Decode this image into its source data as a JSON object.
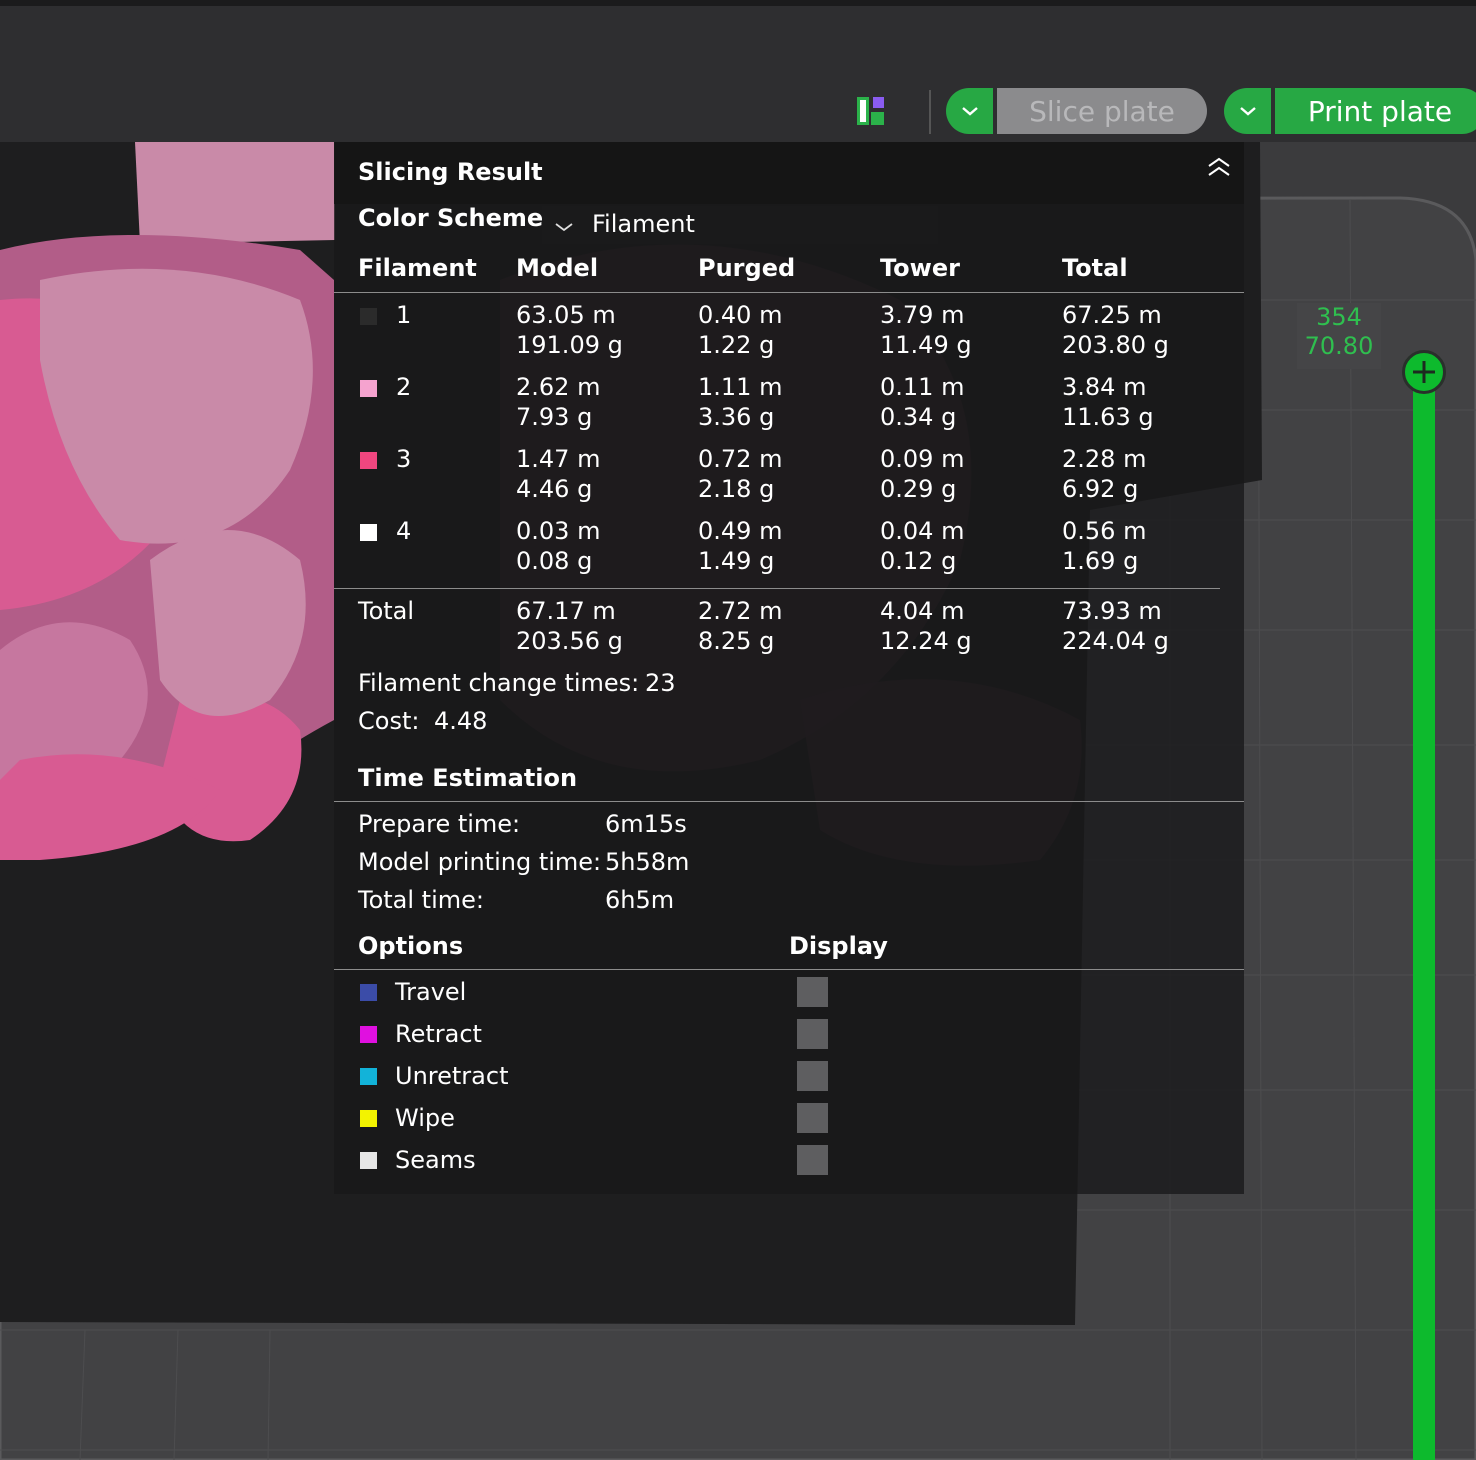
{
  "toolbar": {
    "slice_label": "Slice plate",
    "print_label": "Print plate",
    "layout_icon": "layout-grid-icon"
  },
  "layer_slider": {
    "top_layer": "354",
    "height": "70.80"
  },
  "panel": {
    "title": "Slicing Result",
    "color_scheme_label": "Color Scheme",
    "color_scheme_value": "Filament",
    "columns": [
      "Filament",
      "Model",
      "Purged",
      "Tower",
      "Total"
    ],
    "rows": [
      {
        "id": "1",
        "color": "#2b2b2b",
        "model_m": "63.05 m",
        "model_g": "191.09 g",
        "purged_m": "0.40 m",
        "purged_g": "1.22 g",
        "tower_m": "3.79 m",
        "tower_g": "11.49 g",
        "total_m": "67.25 m",
        "total_g": "203.80 g"
      },
      {
        "id": "2",
        "color": "#f5a3cf",
        "model_m": "2.62 m",
        "model_g": "7.93 g",
        "purged_m": "1.11 m",
        "purged_g": "3.36 g",
        "tower_m": "0.11 m",
        "tower_g": "0.34 g",
        "total_m": "3.84 m",
        "total_g": "11.63 g"
      },
      {
        "id": "3",
        "color": "#f0467f",
        "model_m": "1.47 m",
        "model_g": "4.46 g",
        "purged_m": "0.72 m",
        "purged_g": "2.18 g",
        "tower_m": "0.09 m",
        "tower_g": "0.29 g",
        "total_m": "2.28 m",
        "total_g": "6.92 g"
      },
      {
        "id": "4",
        "color": "#ffffff",
        "model_m": "0.03 m",
        "model_g": "0.08 g",
        "purged_m": "0.49 m",
        "purged_g": "1.49 g",
        "tower_m": "0.04 m",
        "tower_g": "0.12 g",
        "total_m": "0.56 m",
        "total_g": "1.69 g"
      }
    ],
    "total": {
      "label": "Total",
      "model_m": "67.17 m",
      "model_g": "203.56 g",
      "purged_m": "2.72 m",
      "purged_g": "8.25 g",
      "tower_m": "4.04 m",
      "tower_g": "12.24 g",
      "total_m": "73.93 m",
      "total_g": "224.04 g"
    },
    "filament_change_label": "Filament change times:",
    "filament_change_value": "23",
    "cost_label": "Cost:",
    "cost_value": "4.48",
    "time_title": "Time Estimation",
    "prepare_label": "Prepare time:",
    "prepare_value": "6m15s",
    "model_time_label": "Model printing time:",
    "model_time_value": "5h58m",
    "total_time_label": "Total time:",
    "total_time_value": "6h5m",
    "options_title": "Options",
    "display_title": "Display",
    "options": [
      {
        "label": "Travel",
        "color": "#3b4ca8"
      },
      {
        "label": "Retract",
        "color": "#e010e0"
      },
      {
        "label": "Unretract",
        "color": "#12b3d9"
      },
      {
        "label": "Wipe",
        "color": "#f3f300"
      },
      {
        "label": "Seams",
        "color": "#e6e6e6"
      }
    ]
  }
}
